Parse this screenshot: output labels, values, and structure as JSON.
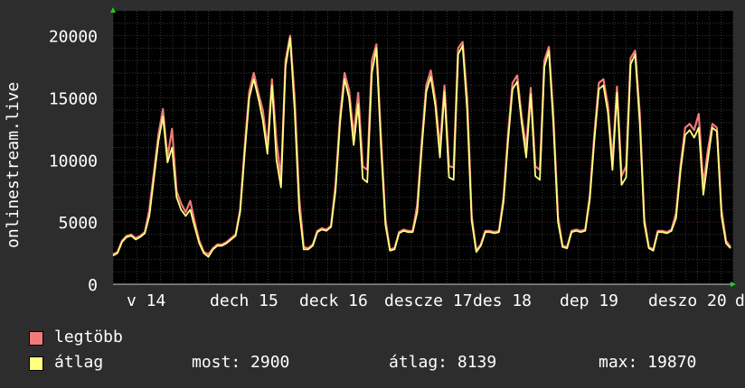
{
  "chart_data": {
    "type": "area",
    "ylabel": "onlinestream.live",
    "ylim": [
      0,
      22000
    ],
    "y_ticks": [
      "0",
      "5000",
      "10000",
      "15000",
      "20000"
    ],
    "x_ticks": [
      "v 14",
      "dech 15",
      "deck 16",
      "descze 17",
      "des 18",
      "dep 19",
      "deszo 20",
      "de"
    ],
    "grid": true,
    "legend_position": "bottom-left",
    "x_days": [
      0,
      6.5
    ],
    "series": [
      {
        "name": "legtöbb",
        "color": "#f27a7a",
        "values": [
          2400,
          2600,
          3500,
          3900,
          4000,
          3700,
          3900,
          4200,
          6000,
          9000,
          12000,
          14100,
          10200,
          12500,
          7500,
          6500,
          5800,
          6700,
          5000,
          3500,
          2600,
          2400,
          2900,
          3200,
          3200,
          3400,
          3700,
          4000,
          6000,
          11000,
          15500,
          17000,
          15400,
          14000,
          11000,
          16500,
          11500,
          8500,
          18000,
          20000,
          15000,
          7000,
          3000,
          2900,
          3200,
          4300,
          4500,
          4400,
          4700,
          8000,
          13500,
          17000,
          15600,
          12000,
          15400,
          9500,
          9200,
          18000,
          19300,
          12000,
          5200,
          2800,
          2900,
          4200,
          4400,
          4300,
          4300,
          6400,
          11500,
          16000,
          17200,
          14800,
          11000,
          16000,
          9500,
          9400,
          19000,
          19500,
          15000,
          5500,
          2700,
          3200,
          4300,
          4300,
          4200,
          4300,
          7000,
          12000,
          16200,
          16800,
          13500,
          11000,
          15800,
          9500,
          9200,
          18000,
          19100,
          13500,
          5400,
          3100,
          3000,
          4300,
          4400,
          4300,
          4400,
          7100,
          12000,
          16200,
          16500,
          14400,
          9900,
          15900,
          8700,
          9500,
          18200,
          18800,
          13800,
          5300,
          3000,
          2800,
          4300,
          4300,
          4200,
          4400,
          5700,
          9600,
          12600,
          12900,
          12400,
          13700,
          8000,
          10800,
          12900,
          12600,
          6000,
          3500,
          3000
        ]
      },
      {
        "name": "átlag",
        "color": "#ffff80",
        "values": [
          2300,
          2500,
          3400,
          3800,
          3900,
          3600,
          3800,
          4100,
          5500,
          8500,
          11500,
          13500,
          9800,
          11000,
          7000,
          6000,
          5500,
          6000,
          4600,
          3300,
          2500,
          2200,
          2800,
          3100,
          3100,
          3300,
          3600,
          3900,
          5800,
          10500,
          15000,
          16500,
          15000,
          13200,
          10500,
          16000,
          10000,
          7800,
          17500,
          19800,
          14000,
          6000,
          2800,
          2800,
          3100,
          4200,
          4400,
          4300,
          4600,
          7500,
          13000,
          16500,
          15000,
          11200,
          14500,
          8500,
          8200,
          17000,
          19000,
          11200,
          4800,
          2700,
          2800,
          4100,
          4300,
          4200,
          4200,
          5800,
          11000,
          15500,
          16700,
          14300,
          10200,
          15500,
          8600,
          8400,
          18500,
          19200,
          14000,
          5100,
          2600,
          3100,
          4200,
          4200,
          4100,
          4200,
          6600,
          11500,
          15700,
          16300,
          13000,
          10200,
          15300,
          8700,
          8400,
          17500,
          18800,
          12800,
          5000,
          3000,
          2900,
          4200,
          4300,
          4200,
          4300,
          6800,
          11500,
          15700,
          16000,
          13800,
          9200,
          15400,
          8000,
          8600,
          17700,
          18500,
          13000,
          4900,
          2900,
          2700,
          4200,
          4200,
          4100,
          4300,
          5300,
          9200,
          12000,
          12400,
          11800,
          12600,
          7200,
          10000,
          12600,
          12300,
          5500,
          3300,
          2900
        ]
      }
    ]
  },
  "legend": {
    "items": [
      {
        "label": "legtöbb",
        "color": "#f27a7a"
      },
      {
        "label": "átlag",
        "color": "#ffff80"
      }
    ],
    "stats": {
      "most": "most: 2900",
      "atlag": "átlag: 8139",
      "max": "max: 19870"
    }
  }
}
